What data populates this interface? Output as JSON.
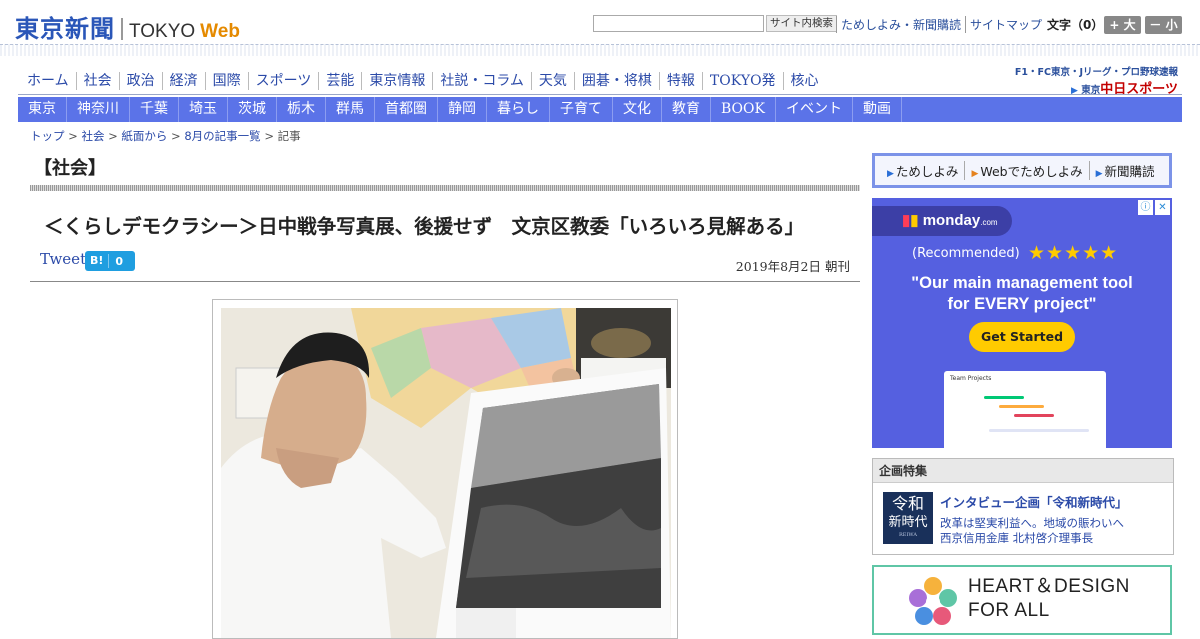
{
  "header": {
    "logo_jp": "東京新聞",
    "logo_en_1": "TOKYO",
    "logo_en_2": "Web",
    "search_placeholder": "",
    "search_button": "サイト内検索",
    "links": [
      "ためしよみ・新聞購読",
      "サイトマップ"
    ],
    "font_size_label": "文字（0）",
    "font_larger": "+ 大",
    "font_smaller": "－ 小"
  },
  "nav_primary": [
    "ホーム",
    "社会",
    "政治",
    "経済",
    "国際",
    "スポーツ",
    "芸能",
    "東京情報",
    "社説・コラム",
    "天気",
    "囲碁・将棋",
    "特報",
    "TOKYO発",
    "核心"
  ],
  "sports_banner": {
    "line1": "F1・FC東京・Jリーグ・プロ野球速報",
    "line2_prefix": "東京",
    "line2_main": "中日スポーツ"
  },
  "nav_regional": [
    "東京",
    "神奈川",
    "千葉",
    "埼玉",
    "茨城",
    "栃木",
    "群馬",
    "首都圏",
    "静岡",
    "暮らし",
    "子育て",
    "文化",
    "教育",
    "BOOK",
    "イベント",
    "動画"
  ],
  "breadcrumb": [
    "トップ",
    "社会",
    "紙面から",
    "8月の記事一覧",
    "記事"
  ],
  "breadcrumb_sep": " > ",
  "section_title": "【社会】",
  "article": {
    "headline": "＜くらしデモクラシー＞日中戦争写真展、後援せず　文京区教委「いろいろ見解ある」",
    "tweet_label": "Tweet",
    "hatena_label": "B!",
    "hatena_count": "0",
    "date": "2019年8月2日 朝刊"
  },
  "sidebar": {
    "trial_links": [
      "ためしよみ",
      "Webでためしよみ",
      "新聞購読"
    ],
    "ad": {
      "brand": "monday",
      "brand_suffix": ".com",
      "recommended": "(Recommended)",
      "stars": "★★★★★",
      "headline_1": "\"Our main management tool",
      "headline_2": "for EVERY project\"",
      "cta": "Get Started",
      "mock_title": "Team Projects"
    },
    "feature": {
      "header": "企画特集",
      "badge_1": "令和",
      "badge_2": "新時代",
      "badge_3": "REIWA",
      "title": "インタビュー企画「令和新時代」",
      "line_1": "改革は堅実利益へ。地域の賑わいへ",
      "line_2": "西京信用金庫 北村啓介理事長"
    },
    "heart_banner": {
      "line_1": "HEART＆DESIGN",
      "line_2": "FOR ALL"
    }
  },
  "colors": {
    "brand_blue": "#2a56b8",
    "nav_blue": "#5b73e8",
    "link_blue": "#2b4aa8",
    "web_orange": "#e58a00",
    "ad_purple": "#5560e0",
    "cta_yellow": "#ffcb00",
    "heart_green": "#5fc6a6"
  }
}
